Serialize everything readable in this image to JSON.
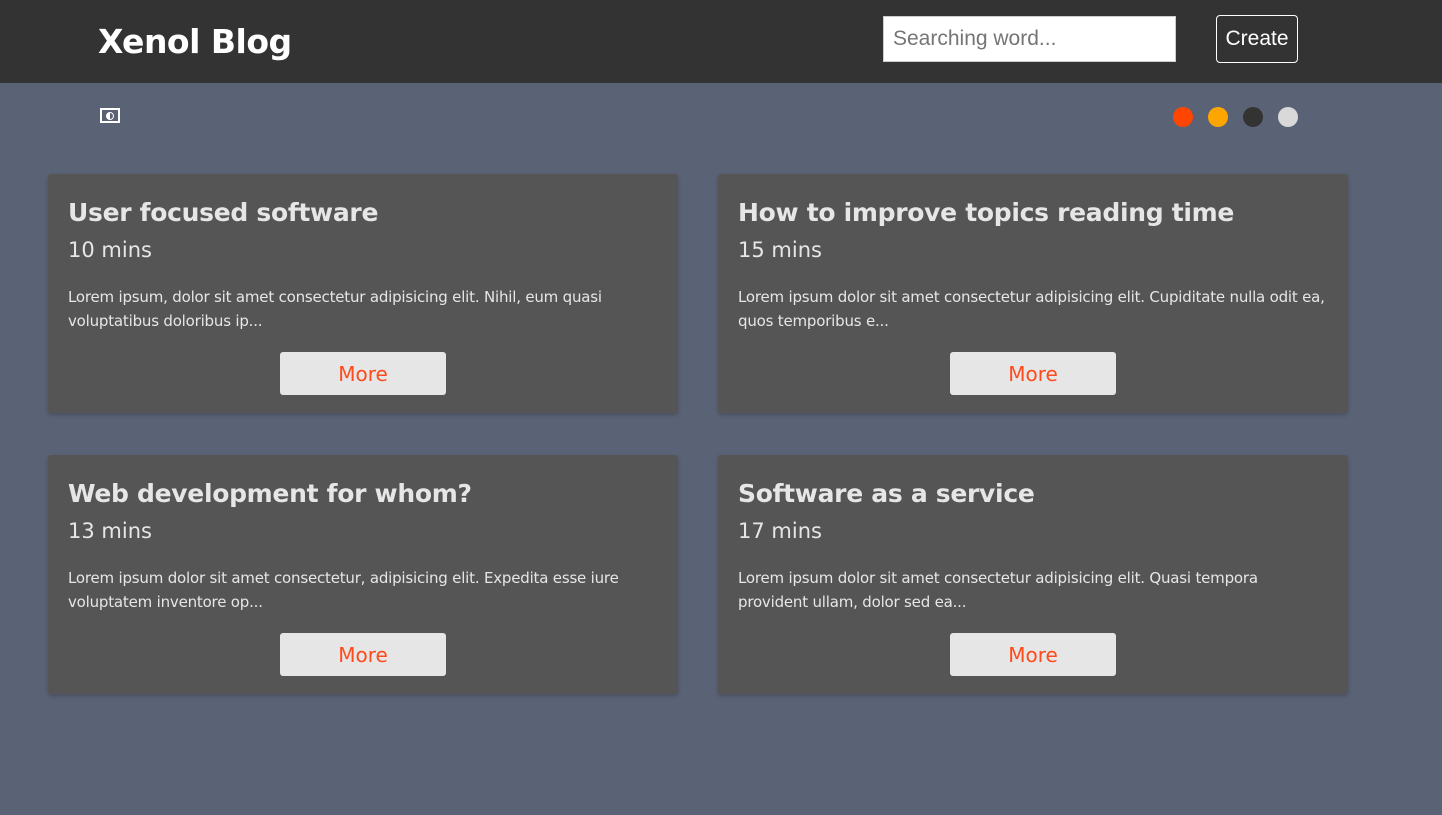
{
  "header": {
    "logo": "Xenol Blog",
    "search_placeholder": "Searching word...",
    "create_label": "Create"
  },
  "theme": {
    "contrast_icon": "contrast-icon",
    "colors": [
      "#ff4500",
      "#ffa500",
      "#333333",
      "#d9d9d9"
    ]
  },
  "posts": [
    {
      "title": "User focused software",
      "time": "10 mins",
      "excerpt": "Lorem ipsum, dolor sit amet consectetur adipisicing elit. Nihil, eum quasi voluptatibus doloribus ip...",
      "more": "More"
    },
    {
      "title": "How to improve topics reading time",
      "time": "15 mins",
      "excerpt": "Lorem ipsum dolor sit amet consectetur adipisicing elit. Cupiditate nulla odit ea, quos temporibus e...",
      "more": "More"
    },
    {
      "title": "Web development for whom?",
      "time": "13 mins",
      "excerpt": "Lorem ipsum dolor sit amet consectetur, adipisicing elit. Expedita esse iure voluptatem inventore op...",
      "more": "More"
    },
    {
      "title": "Software as a service",
      "time": "17 mins",
      "excerpt": "Lorem ipsum dolor sit amet consectetur adipisicing elit. Quasi tempora provident ullam, dolor sed ea...",
      "more": "More"
    }
  ]
}
